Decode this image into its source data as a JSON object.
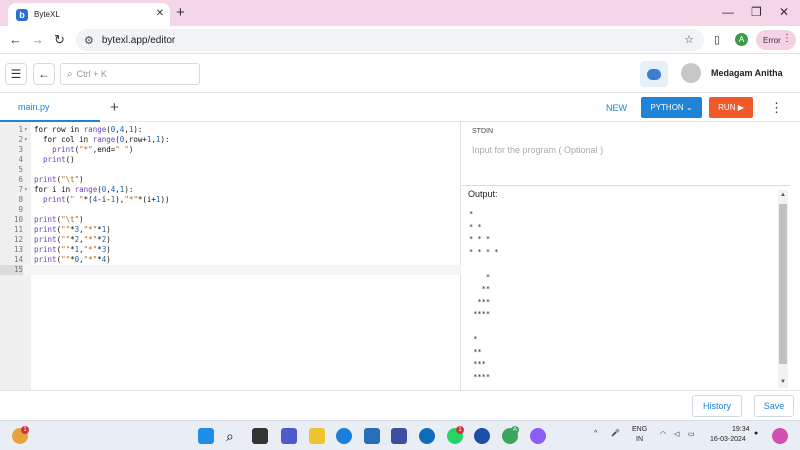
{
  "browser": {
    "tab_title": "ByteXL",
    "favicon_letter": "b",
    "close_glyph": "✕",
    "new_tab_glyph": "+",
    "window_controls": [
      "—",
      "❐",
      "✕"
    ],
    "url": "bytexl.app/editor",
    "profile_letter": "A",
    "error_label": "Error",
    "menu_glyph": "⋮",
    "back_glyph": "←",
    "forward_glyph": "→",
    "reload_glyph": "↻"
  },
  "app": {
    "search_placeholder": "Ctrl + K",
    "user_name": "Medagam Anitha"
  },
  "toolbar": {
    "file_tab": "main.py",
    "add_glyph": "+",
    "new_label": "NEW",
    "language_label": "PYTHON ⌄",
    "run_label": "RUN ▶",
    "more_glyph": "⋮"
  },
  "editor": {
    "lines": [
      {
        "n": "1",
        "fold": "▾"
      },
      {
        "n": "2",
        "fold": "▾"
      },
      {
        "n": "3",
        "fold": ""
      },
      {
        "n": "4",
        "fold": ""
      },
      {
        "n": "5",
        "fold": ""
      },
      {
        "n": "6",
        "fold": ""
      },
      {
        "n": "7",
        "fold": "▾"
      },
      {
        "n": "8",
        "fold": ""
      },
      {
        "n": "9",
        "fold": ""
      },
      {
        "n": "10",
        "fold": ""
      },
      {
        "n": "11",
        "fold": ""
      },
      {
        "n": "12",
        "fold": ""
      },
      {
        "n": "13",
        "fold": ""
      },
      {
        "n": "14",
        "fold": ""
      },
      {
        "n": "15",
        "fold": ""
      }
    ],
    "code": [
      "for row in range(0,4,1):",
      "  for col in range(0,row+1,1):",
      "    print(\"*\",end=\" \")",
      "  print()",
      "",
      "print(\"\\t\")",
      "for i in range(0,4,1):",
      "  print(\" \"*(4-i-1),\"*\"*(i+1))",
      "",
      "print(\"\\t\")",
      "print(\"\"*3,\"*\"*1)",
      "print(\"\"*2,\"*\"*2)",
      "print(\"\"*1,\"*\"*3)",
      "print(\"\"*0,\"*\"*4)",
      ""
    ],
    "active_line": 15
  },
  "stdin": {
    "label": "STDIN",
    "placeholder": "Input for the program ( Optional )"
  },
  "output": {
    "label": "Output:",
    "text": "*\n* *\n* * *\n* * * *\n\n    *\n   **\n  ***\n ****\n\n *\n **\n ***\n ****"
  },
  "footer": {
    "history_label": "History",
    "save_label": "Save"
  },
  "taskbar": {
    "weather_badge": "1",
    "teams_badge": "",
    "whatsapp_badge": "1",
    "chrome_badge": "A",
    "lang_top": "ENG",
    "lang_bottom": "IN",
    "time": "19:34",
    "date": "16-03-2024"
  },
  "colors": {
    "accent": "#1f83d8",
    "run": "#f05a28",
    "tabstrip": "#f4d6e8"
  }
}
